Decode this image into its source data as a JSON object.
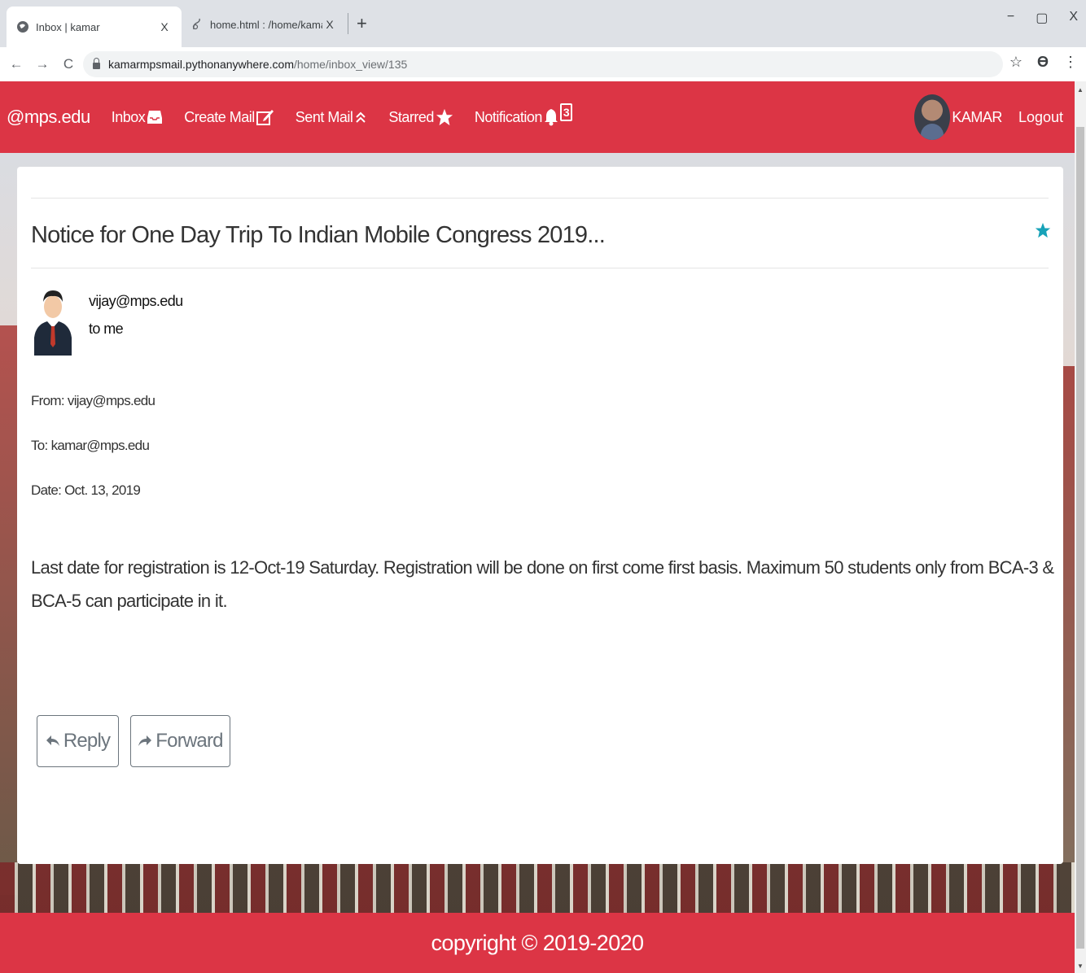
{
  "browser": {
    "tabs": [
      {
        "title": "Inbox | kamar",
        "close": "X"
      },
      {
        "title": "home.html : /home/kamarmpsmail",
        "close": "X"
      }
    ],
    "new_tab": "+",
    "window_controls": {
      "minimize": "−",
      "maximize": "▢",
      "close": "X"
    },
    "nav": {
      "back": "←",
      "forward": "→",
      "reload": "C"
    },
    "url": {
      "host": "kamarmpsmail.pythonanywhere.com",
      "path": "/home/inbox_view/135"
    },
    "bookmark_star": "☆",
    "profile": "ϴ",
    "menu": "⋮"
  },
  "navbar": {
    "brand": "@mps.edu",
    "links": {
      "inbox": "Inbox",
      "create_mail": "Create Mail",
      "sent_mail": "Sent Mail",
      "starred": "Starred",
      "notification": "Notification"
    },
    "notification_count": "3",
    "username": "KAMAR",
    "logout": "Logout"
  },
  "mail": {
    "subject": "Notice for One Day Trip To Indian Mobile Congress 2019...",
    "sender": "vijay@mps.edu",
    "to_me": "to me",
    "from": "From: vijay@mps.edu",
    "to": "To: kamar@mps.edu",
    "date": "Date: Oct. 13, 2019",
    "body": "Last date for registration is 12-Oct-19 Saturday. Registration will be done on first come first basis. Maximum 50 students only from BCA-3 & BCA-5 can participate in it.",
    "reply": "Reply",
    "forward": "Forward",
    "starred_color": "#17a2b8"
  },
  "footer": {
    "text": "copyright © 2019-2020"
  },
  "colors": {
    "brand": "#dc3545"
  }
}
